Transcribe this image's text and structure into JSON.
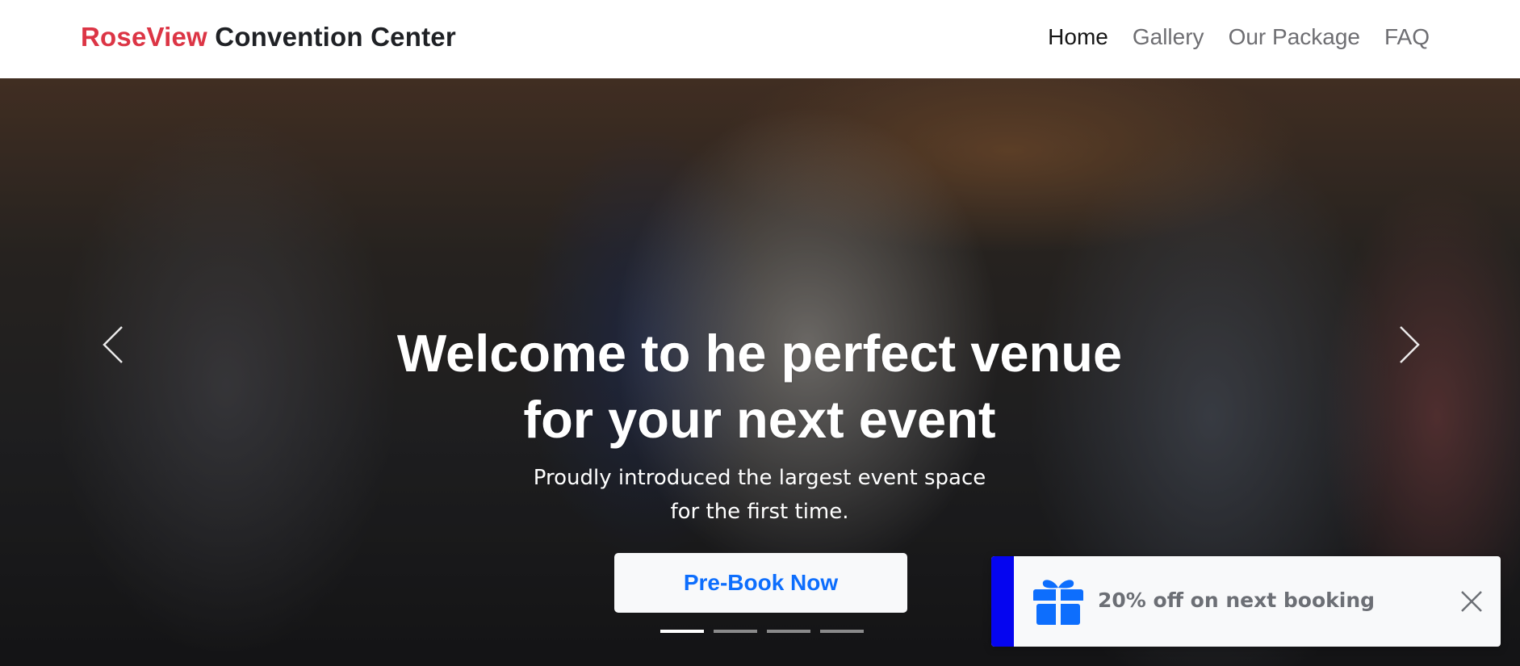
{
  "navbar": {
    "brand_highlight": "RoseView",
    "brand_rest": "Convention Center",
    "links": [
      {
        "label": "Home",
        "active": true
      },
      {
        "label": "Gallery",
        "active": false
      },
      {
        "label": "Our Package",
        "active": false
      },
      {
        "label": "FAQ",
        "active": false
      }
    ]
  },
  "hero": {
    "title_line1": "Welcome to he perfect venue",
    "title_line2": "for your next event",
    "subtitle_line1": "Proudly introduced the largest event space",
    "subtitle_line2": "for the first time.",
    "cta_label": "Pre-Book Now",
    "prev_icon": "chevron-left-icon",
    "next_icon": "chevron-right-icon",
    "slides_total": 4,
    "active_slide": 1
  },
  "toast": {
    "icon": "gift-icon",
    "message": "20% off on next booking",
    "close_icon": "close-icon",
    "accent_color": "#0505f0"
  },
  "colors": {
    "brand_red": "#dc3545",
    "cta_blue": "#0d6efd",
    "gift_blue": "#0d6efd"
  }
}
